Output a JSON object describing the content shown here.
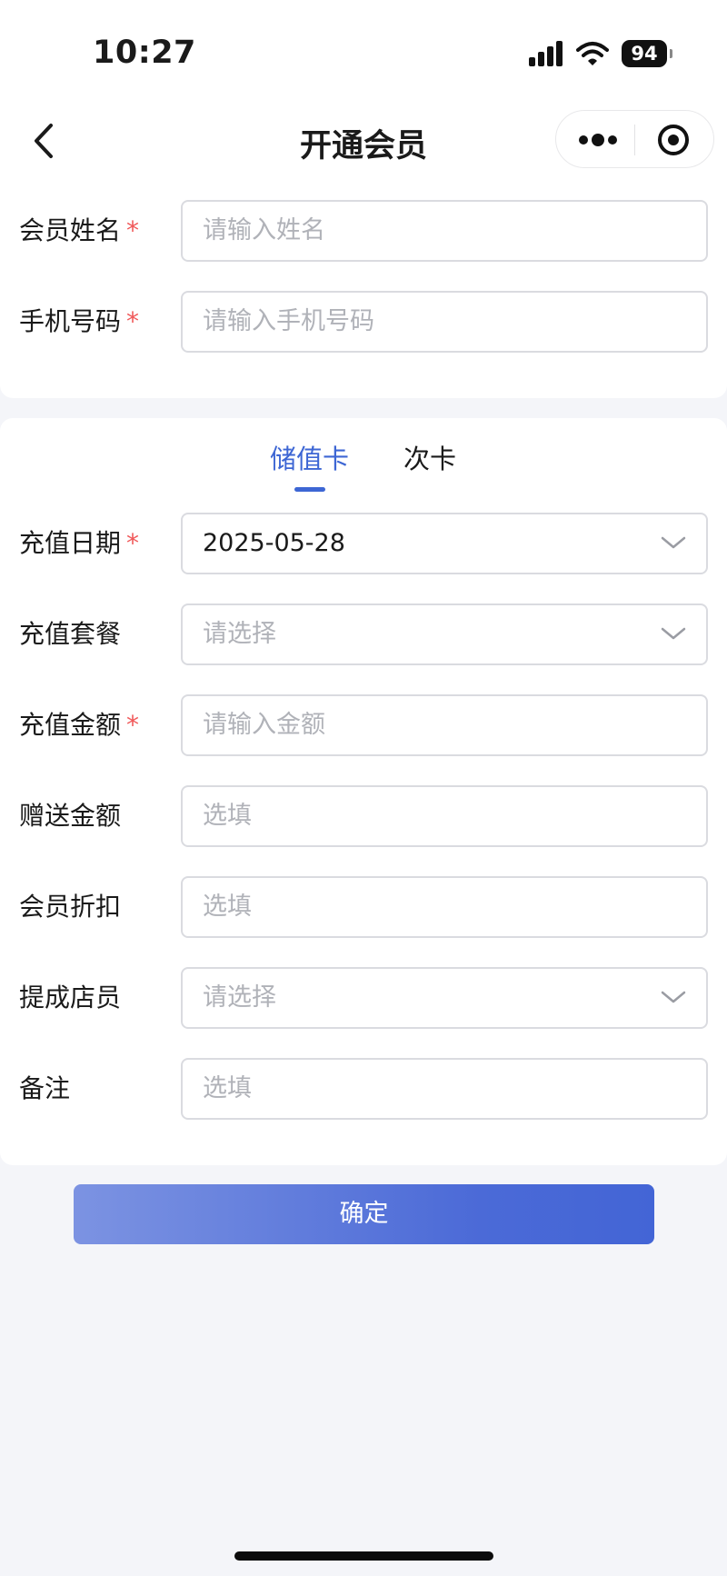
{
  "status_bar": {
    "time": "10:27",
    "battery": "94"
  },
  "nav": {
    "title": "开通会员"
  },
  "member_info": {
    "name": {
      "label": "会员姓名",
      "placeholder": "请输入姓名",
      "required_mark": "*"
    },
    "phone": {
      "label": "手机号码",
      "placeholder": "请输入手机号码",
      "required_mark": "*"
    }
  },
  "tabs": [
    {
      "label": "储值卡",
      "active": true
    },
    {
      "label": "次卡",
      "active": false
    }
  ],
  "form": {
    "recharge_date": {
      "label": "充值日期",
      "value": "2025-05-28",
      "required_mark": "*"
    },
    "package": {
      "label": "充值套餐",
      "placeholder": "请选择"
    },
    "amount": {
      "label": "充值金额",
      "placeholder": "请输入金额",
      "required_mark": "*"
    },
    "bonus": {
      "label": "赠送金额",
      "placeholder": "选填"
    },
    "discount": {
      "label": "会员折扣",
      "placeholder": "选填"
    },
    "staff": {
      "label": "提成店员",
      "placeholder": "请选择"
    },
    "remark": {
      "label": "备注",
      "placeholder": "选填"
    }
  },
  "confirm_label": "确定",
  "colors": {
    "accent": "#3d66d4",
    "required": "#f0595a",
    "placeholder": "#b0b2b8",
    "background": "#f4f5f9"
  }
}
